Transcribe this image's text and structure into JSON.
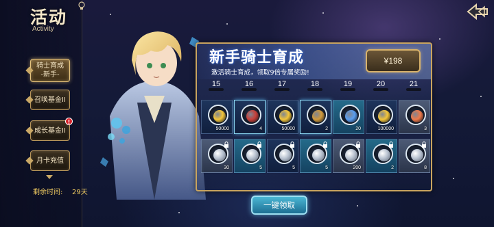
{
  "header": {
    "title": "活动",
    "subtitle": "Activity"
  },
  "sidebar": {
    "items": [
      {
        "line1": "骑士育成",
        "line2": "-新手-",
        "active": true,
        "badge": ""
      },
      {
        "line1": "召唤基金II",
        "line2": "",
        "active": false,
        "badge": ""
      },
      {
        "line1": "成长基金II",
        "line2": "",
        "active": false,
        "badge": "!"
      },
      {
        "line1": "月卡充值",
        "line2": "",
        "active": false,
        "badge": ""
      }
    ],
    "remaining_label": "剩余时间:",
    "remaining_value": "29天"
  },
  "banner": {
    "title": "新手骑士育成",
    "subtitle": "激活骑士育成，领取9倍专属奖励!",
    "price": "¥198"
  },
  "days": [
    "15",
    "16",
    "17",
    "18",
    "19",
    "20",
    "21"
  ],
  "rewards_free": [
    {
      "icon": "gold-coin-icon",
      "qty": "50000",
      "color": "#f3c53a"
    },
    {
      "icon": "red-potion-icon",
      "qty": "4",
      "color": "#c8403a"
    },
    {
      "icon": "gold-coin-icon",
      "qty": "50000",
      "color": "#f3c53a"
    },
    {
      "icon": "treasure-pile-icon",
      "qty": "2",
      "color": "#d29a3c"
    },
    {
      "icon": "blue-crystal-icon",
      "qty": "20",
      "color": "#5a9ef0"
    },
    {
      "icon": "gold-coin-icon",
      "qty": "100000",
      "color": "#f3c53a"
    },
    {
      "icon": "orange-gem-icon",
      "qty": "3",
      "color": "#f07a4a"
    }
  ],
  "rewards_locked": [
    {
      "icon": "silver-ore-icon",
      "qty": "30"
    },
    {
      "icon": "silver-mount-icon",
      "qty": "5"
    },
    {
      "icon": "silver-book-icon",
      "qty": "5"
    },
    {
      "icon": "silver-wings-icon",
      "qty": "5"
    },
    {
      "icon": "silver-shard-icon",
      "qty": "200"
    },
    {
      "icon": "silver-star-icon",
      "qty": "2"
    },
    {
      "icon": "silver-chest-icon",
      "qty": "8"
    }
  ],
  "claim_button": "一键领取"
}
